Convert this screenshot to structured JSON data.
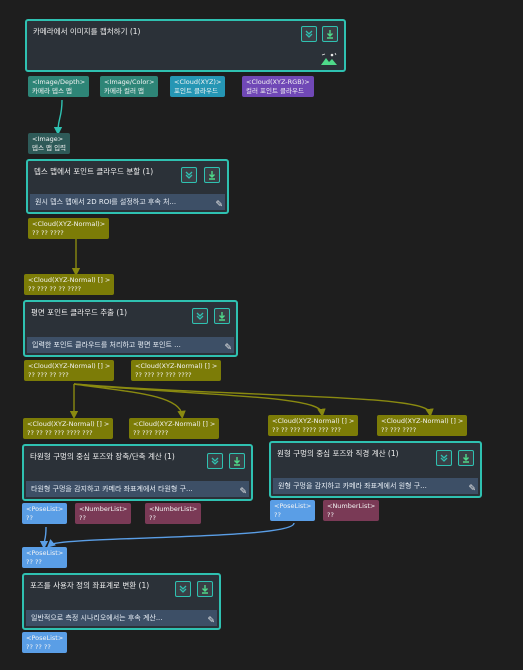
{
  "nodes": {
    "capture": {
      "title": "카메라에서 이미지를 캡처하기 (1)"
    },
    "depth_to_cloud": {
      "title": "뎁스 맵에서 포인트 클라우드 분할 (1)",
      "desc": "원시 뎁스 맵에서 2D ROI를 설정하고 후속 처..."
    },
    "plane_extract": {
      "title": "평면 포인트 클라우드 추출 (1)",
      "desc": "입력한 포인트 클라우드를 처리하고 평면 포인트 ..."
    },
    "ellipse": {
      "title": "타원형 구멍의 중심 포즈와 장축/단축 계산 (1)",
      "desc": "타원형 구멍을 감지하고 카메라 좌표계에서 타원형 구..."
    },
    "circle": {
      "title": "원형 구멍의 중심 포즈와 직경 계산 (1)",
      "desc": "원형 구멍을 감지하고 카메라 좌표계에서 원형 구..."
    },
    "transform": {
      "title": "포즈를 사용자 정의 좌표계로 변환 (1)",
      "desc": "일반적으로 측정 시나리오에서는 후속 계산..."
    }
  },
  "ports": {
    "cap_depth": {
      "type": "<Image/Depth>",
      "label": "카메라 뎁스 맵"
    },
    "cap_color": {
      "type": "<Image/Color>",
      "label": "카메라 컬러 맵"
    },
    "cap_xyz": {
      "type": "<Cloud(XYZ)>",
      "label": "포인트 클라우드"
    },
    "cap_rgb": {
      "type": "<Cloud(XYZ-RGB)>",
      "label": "컬러 포인트 클라우드"
    },
    "d2c_in": {
      "type": "<Image>",
      "label": "뎁스 맵 입력"
    },
    "d2c_out": {
      "type": "<Cloud(XYZ-Normal)>",
      "label": "?? ?? ????"
    },
    "pe_in": {
      "type": "<Cloud(XYZ-Normal) [] >",
      "label": "?? ??? ?? ?? ????"
    },
    "pe_out1": {
      "type": "<Cloud(XYZ-Normal) [] >",
      "label": "?? ??? ?? ???"
    },
    "pe_out2": {
      "type": "<Cloud(XYZ-Normal) [] >",
      "label": "?? ??? ?? ??? ????"
    },
    "el_in1": {
      "type": "<Cloud(XYZ-Normal) [] >",
      "label": "?? ?? ?? ??? ???? ???"
    },
    "el_in2": {
      "type": "<Cloud(XYZ-Normal) [] >",
      "label": "?? ??? ????"
    },
    "ci_in1": {
      "type": "<Cloud(XYZ-Normal) [] >",
      "label": "?? ?? ??? ???? ??? ???"
    },
    "ci_in2": {
      "type": "<Cloud(XYZ-Normal) [] >",
      "label": "?? ??? ????"
    },
    "el_out1": {
      "type": "<PoseList>",
      "label": "??"
    },
    "el_out2": {
      "type": "<NumberList>",
      "label": "??"
    },
    "el_out3": {
      "type": "<NumberList>",
      "label": "??"
    },
    "ci_out1": {
      "type": "<PoseList>",
      "label": "??"
    },
    "ci_out2": {
      "type": "<NumberList>",
      "label": "??"
    },
    "tr_in": {
      "type": "<PoseList>",
      "label": "?? ??"
    },
    "tr_out": {
      "type": "<PoseList>",
      "label": "?? ?? ??"
    }
  },
  "colors": {
    "node_border": "#2fc1b1",
    "wire": "#7c7c07",
    "wire_teal": "#2fc1b1",
    "wire_blue": "#5a9ee6"
  },
  "icons": [
    "chevron-double-down-icon",
    "download-arrow-icon",
    "camera-landscape-icon",
    "edit-icon"
  ]
}
